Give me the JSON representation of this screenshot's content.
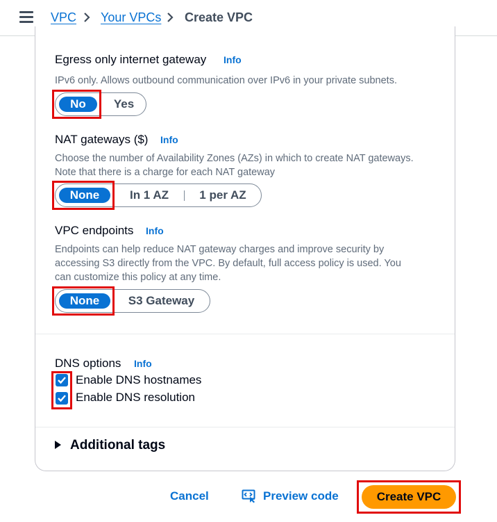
{
  "breadcrumb": {
    "items": [
      "VPC",
      "Your VPCs",
      "Create VPC"
    ]
  },
  "egress": {
    "label": "Egress only internet gateway",
    "info": "Info",
    "description": "IPv6 only. Allows outbound communication over IPv6 in your private subnets.",
    "options": [
      "No",
      "Yes"
    ],
    "selected": "No"
  },
  "nat": {
    "label": "NAT gateways ($)",
    "info": "Info",
    "description_line1": "Choose the number of Availability Zones (AZs) in which to create NAT gateways.",
    "description_line2": "Note that there is a charge for each NAT gateway",
    "options": [
      "None",
      "In 1 AZ",
      "1 per AZ"
    ],
    "selected": "None"
  },
  "endpoints": {
    "label": "VPC endpoints",
    "info": "Info",
    "description_line1": "Endpoints can help reduce NAT gateway charges and improve security by",
    "description_line2": "accessing S3 directly from the VPC. By default, full access policy is used. You",
    "description_line3": "can customize this policy at any time.",
    "options": [
      "None",
      "S3 Gateway"
    ],
    "selected": "None"
  },
  "dns": {
    "label": "DNS options",
    "info": "Info",
    "options": [
      {
        "label": "Enable DNS hostnames",
        "checked": true
      },
      {
        "label": "Enable DNS resolution",
        "checked": true
      }
    ]
  },
  "tags": {
    "label": "Additional tags"
  },
  "actions": {
    "cancel": "Cancel",
    "preview": "Preview code",
    "create": "Create VPC"
  },
  "colors": {
    "accent": "#0972d3",
    "primary_button": "#ff9900",
    "highlight": "#e10b0b"
  }
}
